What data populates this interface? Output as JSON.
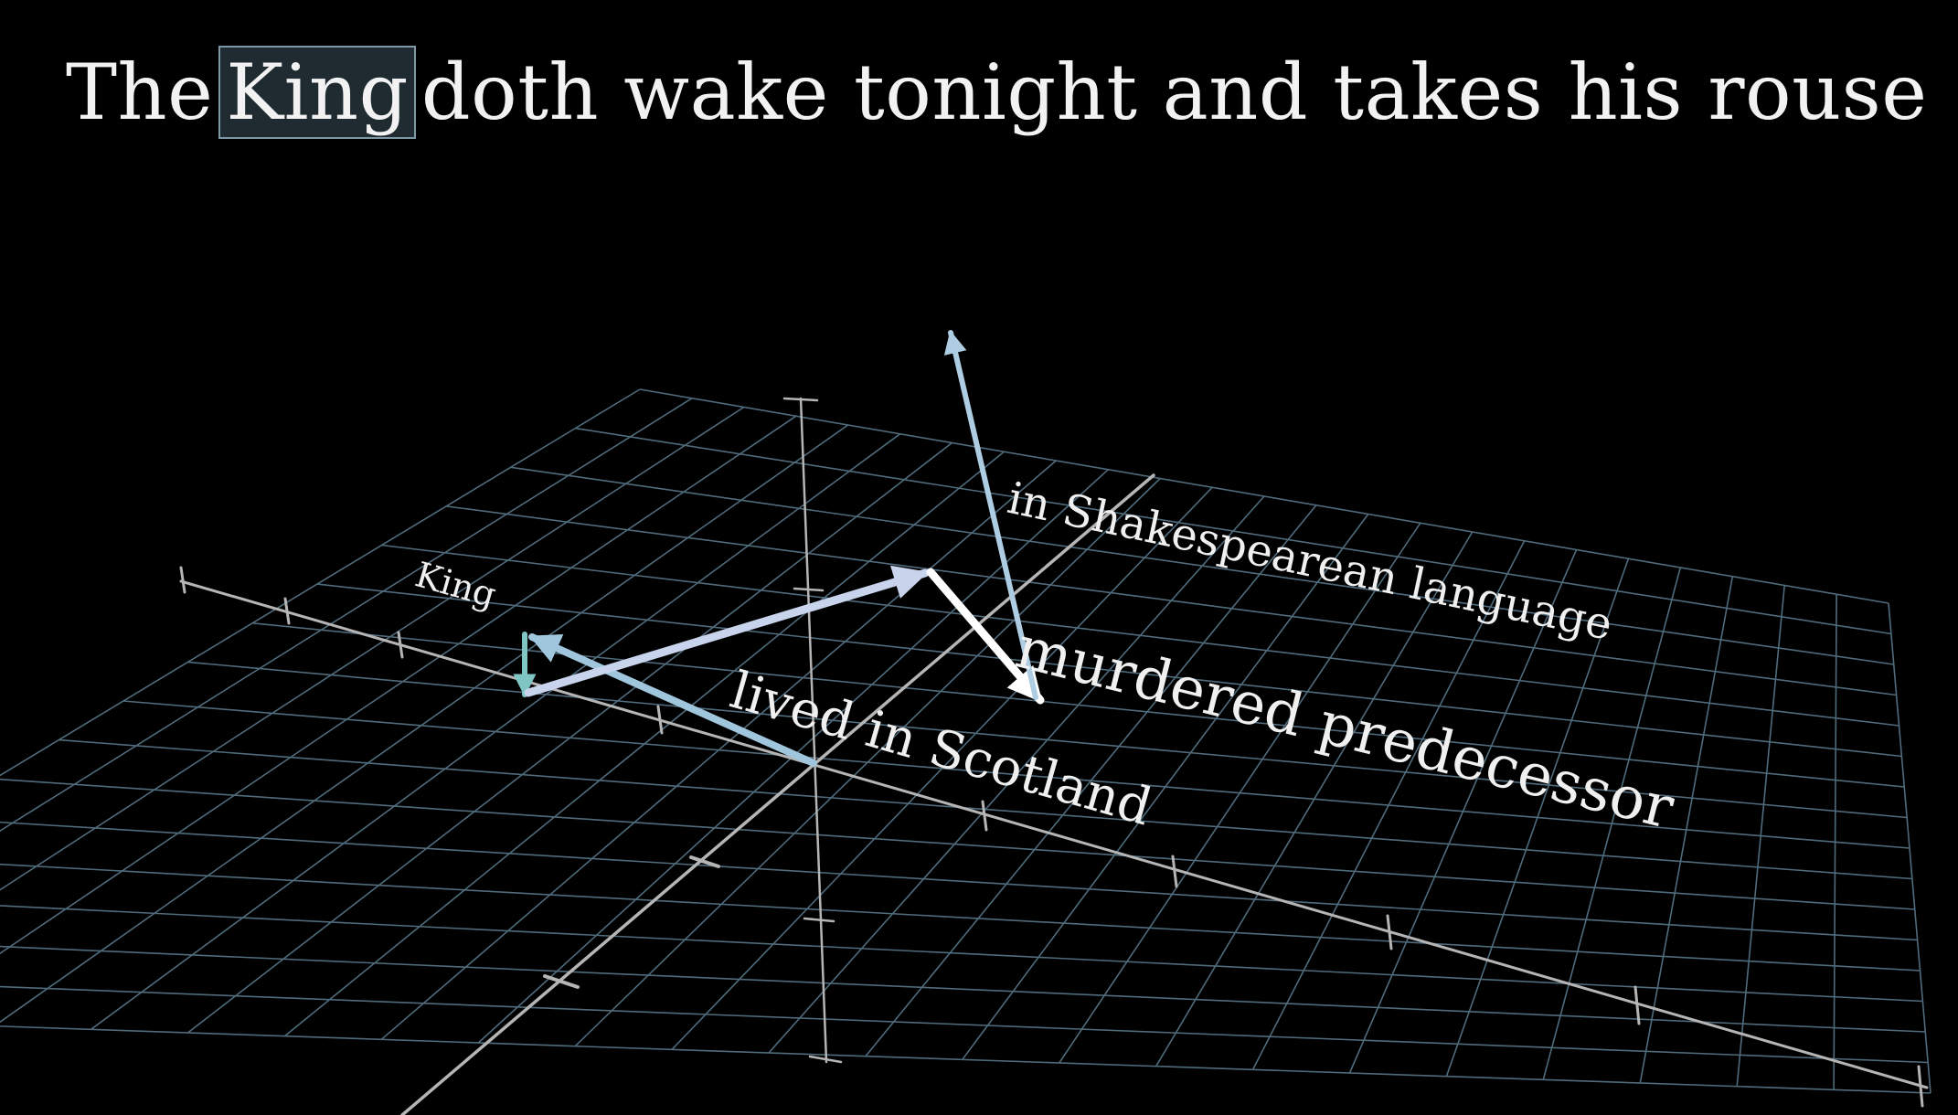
{
  "sentence": {
    "before": "The",
    "highlight": "King",
    "after": "doth wake tonight and takes his rouse ..."
  },
  "labels": {
    "king": "King",
    "scotland": "lived in Scotland",
    "shakespeare": "in Shakespearean language",
    "murdered": "murdered predecessor"
  },
  "colors": {
    "background": "#000000",
    "grid": "#5d7e92",
    "axis": "#b5b5b5",
    "highlight_border": "#7e98a6",
    "highlight_fill": "#1f2b31",
    "vec_teal": "#7fc5c3",
    "vec_light_blue": "#9fc6dc",
    "vec_lavender": "#c8d4ec",
    "vec_white": "#ffffff"
  }
}
